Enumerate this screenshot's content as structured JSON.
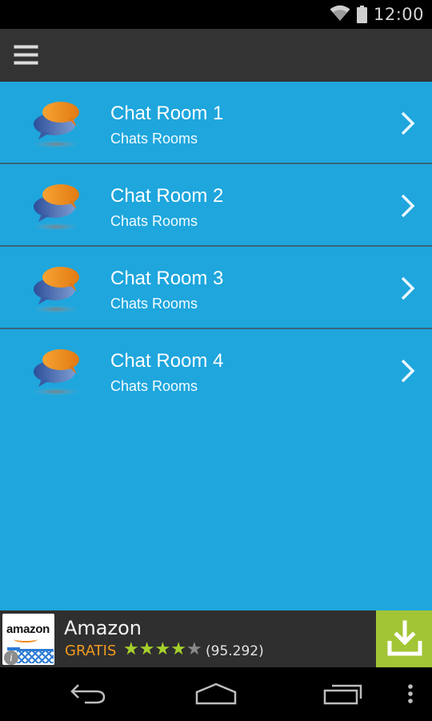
{
  "status_bar": {
    "time": "12:00",
    "icons": [
      "wifi-icon",
      "battery-icon"
    ]
  },
  "action_bar": {
    "menu_icon": "hamburger-menu-icon"
  },
  "colors": {
    "list_background": "#1ea6dd",
    "action_bar": "#333333",
    "divider": "#37657d",
    "ad_background": "#2f2f2f",
    "install_button": "#a2c535",
    "price_text": "#f19a22",
    "star_filled": "#a6d02c",
    "star_empty": "#8a8a8a"
  },
  "chat_rooms": [
    {
      "title": "Chat Room 1",
      "subtitle": "Chats Rooms",
      "icon": "chat-bubbles-icon",
      "chevron": "chevron-right-icon"
    },
    {
      "title": "Chat Room 2",
      "subtitle": "Chats Rooms",
      "icon": "chat-bubbles-icon",
      "chevron": "chevron-right-icon"
    },
    {
      "title": "Chat Room 3",
      "subtitle": "Chats Rooms",
      "icon": "chat-bubbles-icon",
      "chevron": "chevron-right-icon"
    },
    {
      "title": "Chat Room 4",
      "subtitle": "Chats Rooms",
      "icon": "chat-bubbles-icon",
      "chevron": "chevron-right-icon"
    }
  ],
  "ad": {
    "logo_text": "amazon",
    "title": "Amazon",
    "price": "GRATIS",
    "rating": 4,
    "rating_max": 5,
    "rating_count": "(95.292)",
    "info_glyph": "i",
    "install_icon": "download-icon"
  },
  "nav_bar": {
    "buttons": [
      "back-icon",
      "home-icon",
      "recent-apps-icon",
      "overflow-menu-icon"
    ]
  }
}
